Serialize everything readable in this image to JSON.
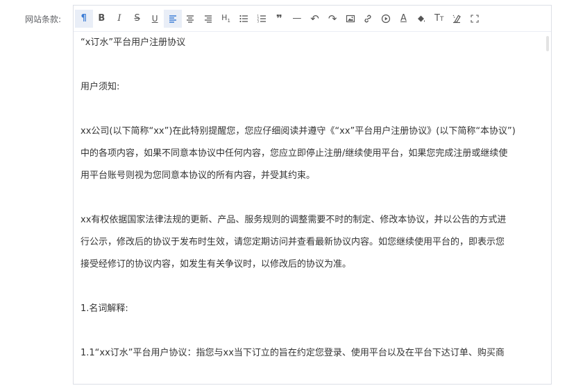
{
  "form": {
    "label": "网站条款:"
  },
  "toolbar": {
    "items": [
      {
        "name": "paragraph-icon",
        "glyph": "¶"
      },
      {
        "name": "bold-icon",
        "glyph": "B"
      },
      {
        "name": "italic-icon",
        "glyph": "I"
      },
      {
        "name": "strikethrough-icon",
        "glyph": "S"
      },
      {
        "name": "underline-icon",
        "glyph": "U"
      },
      {
        "name": "align-left-icon",
        "glyph": ""
      },
      {
        "name": "align-center-icon",
        "glyph": ""
      },
      {
        "name": "align-right-icon",
        "glyph": ""
      },
      {
        "name": "heading-icon",
        "glyph": "H1"
      },
      {
        "name": "bullet-list-icon",
        "glyph": ""
      },
      {
        "name": "ordered-list-icon",
        "glyph": ""
      },
      {
        "name": "quote-icon",
        "glyph": "❞"
      },
      {
        "name": "horizontal-rule-icon",
        "glyph": "—"
      },
      {
        "name": "undo-icon",
        "glyph": "↶"
      },
      {
        "name": "redo-icon",
        "glyph": "↷"
      },
      {
        "name": "image-icon",
        "glyph": ""
      },
      {
        "name": "link-icon",
        "glyph": ""
      },
      {
        "name": "video-icon",
        "glyph": ""
      },
      {
        "name": "font-color-icon",
        "glyph": "A"
      },
      {
        "name": "background-color-icon",
        "glyph": ""
      },
      {
        "name": "font-size-icon",
        "glyph": "TT"
      },
      {
        "name": "clear-format-icon",
        "glyph": ""
      },
      {
        "name": "fullscreen-icon",
        "glyph": ""
      }
    ]
  },
  "content": {
    "title": "“x订水”平台用户注册协议",
    "notice_heading": "用户须知:",
    "para1": [
      "xx公司(以下简称“xx”)在此特别提醒您，您应仔细阅读并遵守《“xx”平台用户注册协议》(以下简称“本协议”)",
      "中的各项内容，如果不同意本协议中任何内容，您应立即停止注册/继续使用平台，如果您完成注册或继续使",
      "用平台账号则视为您同意本协议的所有内容，并受其约束。"
    ],
    "para2": [
      "xx有权依据国家法律法规的更新、产品、服务规则的调整需要不时的制定、修改本协议，并以公告的方式进",
      "行公示，修改后的协议于发布时生效，请您定期访问并查看最新协议内容。如您继续使用平台的，即表示您",
      "接受经修订的协议内容，如发生有关争议时，以修改后的协议为准。"
    ],
    "section1_heading": "1.名词解释:",
    "section1_1": "1.1“xx订水”平台用户协议：指您与xx当下订立的旨在约定您登录、使用平台以及在平台下达订单、购买商"
  }
}
